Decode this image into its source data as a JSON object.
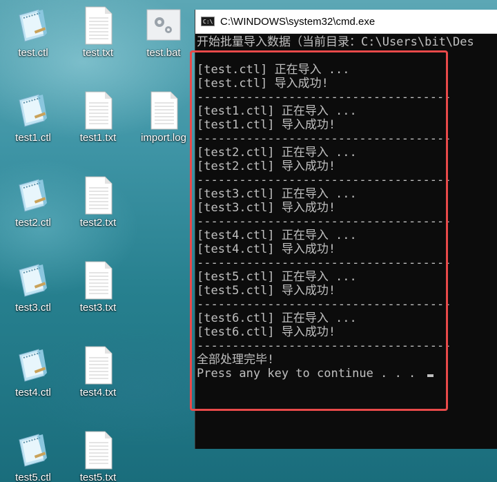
{
  "desktop": {
    "icons": [
      {
        "label": "test.ctl",
        "type": "ctl-icon"
      },
      {
        "label": "test.txt",
        "type": "txt-icon"
      },
      {
        "label": "test.bat",
        "type": "bat-icon"
      },
      {
        "label": "test1.ctl",
        "type": "ctl-icon"
      },
      {
        "label": "test1.txt",
        "type": "txt-icon"
      },
      {
        "label": "import.log",
        "type": "txt-icon"
      },
      {
        "label": "test2.ctl",
        "type": "ctl-icon"
      },
      {
        "label": "test2.txt",
        "type": "txt-icon"
      },
      {
        "label": "test3.ctl",
        "type": "ctl-icon"
      },
      {
        "label": "test3.txt",
        "type": "txt-icon"
      },
      {
        "label": "test4.ctl",
        "type": "ctl-icon"
      },
      {
        "label": "test4.txt",
        "type": "txt-icon"
      },
      {
        "label": "test5.ctl",
        "type": "ctl-icon"
      },
      {
        "label": "test5.txt",
        "type": "txt-icon"
      }
    ]
  },
  "window": {
    "title": "C:\\WINDOWS\\system32\\cmd.exe",
    "icon_text": "C:\\"
  },
  "console": {
    "lines": [
      "开始批量导入数据（当前目录：C:\\Users\\bit\\Des",
      "",
      "[test.ctl] 正在导入 ...",
      "[test.ctl] 导入成功!",
      "------------------------------------",
      "[test1.ctl] 正在导入 ...",
      "[test1.ctl] 导入成功!",
      "------------------------------------",
      "[test2.ctl] 正在导入 ...",
      "[test2.ctl] 导入成功!",
      "------------------------------------",
      "[test3.ctl] 正在导入 ...",
      "[test3.ctl] 导入成功!",
      "------------------------------------",
      "[test4.ctl] 正在导入 ...",
      "[test4.ctl] 导入成功!",
      "------------------------------------",
      "[test5.ctl] 正在导入 ...",
      "[test5.ctl] 导入成功!",
      "------------------------------------",
      "[test6.ctl] 正在导入 ...",
      "[test6.ctl] 导入成功!",
      "------------------------------------",
      "全部处理完毕!",
      "Press any key to continue . . . "
    ]
  },
  "colors": {
    "highlight": "#e94a4a",
    "console_bg": "#0c0c0c",
    "console_fg": "#c0c0c0"
  }
}
